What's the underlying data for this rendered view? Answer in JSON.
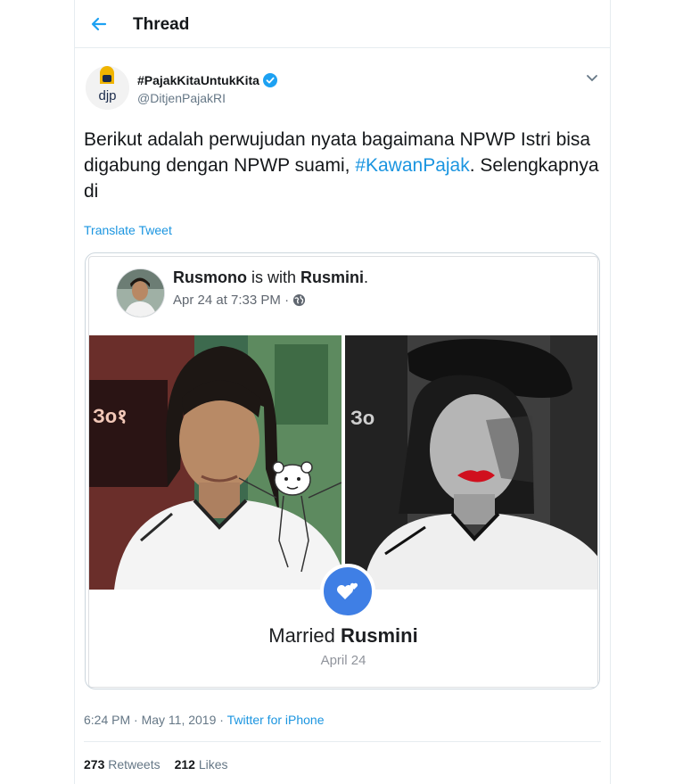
{
  "header": {
    "title": "Thread",
    "back_icon": "arrow-left-icon"
  },
  "tweet": {
    "avatar_text": "djp",
    "display_name": "#PajakKitaUntukKita",
    "handle": "@DitjenPajakRI",
    "verified_icon": "verified-badge-icon",
    "caret_icon": "chevron-down-icon",
    "text_part1": "Berikut adalah perwujudan nyata bagaimana NPWP Istri bisa digabung dengan NPWP suami, ",
    "hashtag": "#KawanPajak",
    "text_part2": ". Selengkapnya di",
    "translate": "Translate Tweet"
  },
  "fb_card": {
    "poster": "Rusmono",
    "with_text": " is with ",
    "partner": "Rusmini",
    "period": ".",
    "time": "Apr 24 at 7:33 PM",
    "separator": " · ",
    "globe_icon": "globe-icon",
    "heart_icon": "hearts-icon",
    "event_prefix": "Married ",
    "event_name": "Rusmini",
    "event_date": "April 24"
  },
  "meta": {
    "time": "6:24 PM · May 11, 2019 · ",
    "source": "Twitter for iPhone"
  },
  "stats": {
    "retweets_count": "273",
    "retweets_label": "Retweets",
    "likes_count": "212",
    "likes_label": "Likes"
  },
  "colors": {
    "link": "#1b95e0",
    "verified": "#1da1f2",
    "lips": "#d0101e",
    "heart_badge": "#3f7fe5"
  }
}
